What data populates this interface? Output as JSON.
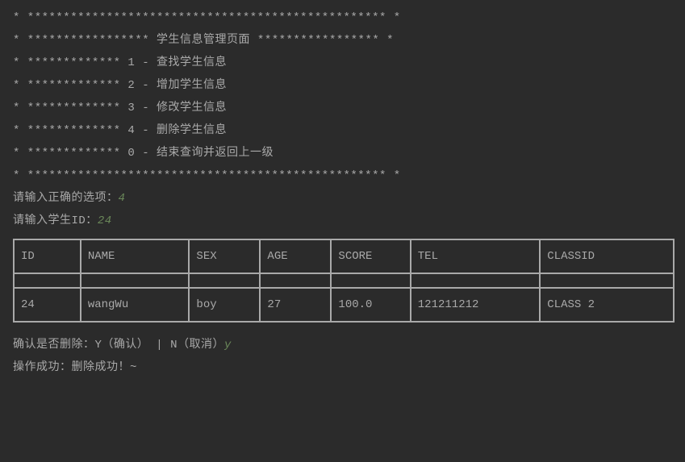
{
  "menu": {
    "border_top": "* ************************************************** *",
    "title_line": "* ***************** 学生信息管理页面 ***************** *",
    "option1": "* ************* 1 - 查找学生信息",
    "option2": "* ************* 2 - 增加学生信息",
    "option3": "* ************* 3 - 修改学生信息",
    "option4": "* ************* 4 - 删除学生信息",
    "option0": "* ************* 0 - 结束查询并返回上一级",
    "border_bottom": "* ************************************************** *"
  },
  "prompts": {
    "select_label": "请输入正确的选项：",
    "select_value": "4",
    "id_label": "请输入学生ID：",
    "id_value": "24"
  },
  "table": {
    "headers": {
      "id": "ID",
      "name": "NAME",
      "sex": "SEX",
      "age": "AGE",
      "score": "SCORE",
      "tel": "TEL",
      "classid": "CLASSID"
    },
    "row": {
      "id": "24",
      "name": "wangWu",
      "sex": "boy",
      "age": "27",
      "score": "100.0",
      "tel": "121211212",
      "classid": "CLASS 2"
    }
  },
  "confirm": {
    "prompt": "确认是否删除：Y（确认） | N（取消）",
    "value": "y"
  },
  "result": "操作成功：删除成功！~"
}
